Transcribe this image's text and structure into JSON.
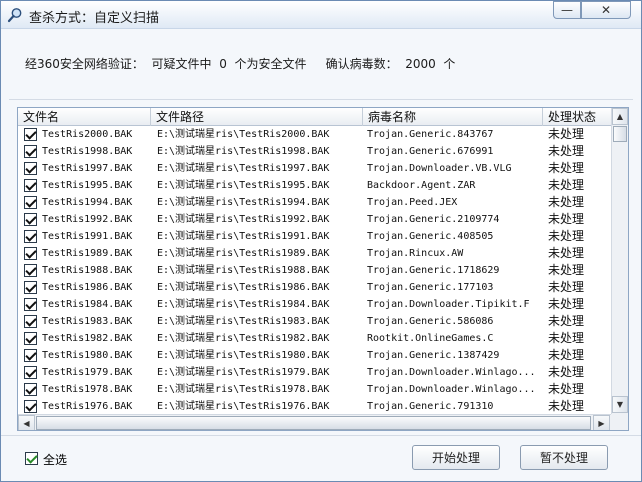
{
  "window": {
    "title": "查杀方式：自定义扫描",
    "min_label": "—",
    "close_label": "✕",
    "title_icon": "magnifier-icon"
  },
  "info": {
    "part1": "经360安全网络验证：",
    "part2": "可疑文件中",
    "safe_count": "0",
    "part3": "个为安全文件",
    "part4": "确认病毒数：",
    "virus_count": "2000",
    "part5": "个"
  },
  "table": {
    "columns": [
      "文件名",
      "文件路径",
      "病毒名称",
      "处理状态"
    ],
    "rows": [
      {
        "file": "TestRis2000.BAK",
        "path": "E:\\测试瑞星ris\\TestRis2000.BAK",
        "virus": "Trojan.Generic.843767",
        "status": "未处理"
      },
      {
        "file": "TestRis1998.BAK",
        "path": "E:\\测试瑞星ris\\TestRis1998.BAK",
        "virus": "Trojan.Generic.676991",
        "status": "未处理"
      },
      {
        "file": "TestRis1997.BAK",
        "path": "E:\\测试瑞星ris\\TestRis1997.BAK",
        "virus": "Trojan.Downloader.VB.VLG",
        "status": "未处理"
      },
      {
        "file": "TestRis1995.BAK",
        "path": "E:\\测试瑞星ris\\TestRis1995.BAK",
        "virus": "Backdoor.Agent.ZAR",
        "status": "未处理"
      },
      {
        "file": "TestRis1994.BAK",
        "path": "E:\\测试瑞星ris\\TestRis1994.BAK",
        "virus": "Trojan.Peed.JEX",
        "status": "未处理"
      },
      {
        "file": "TestRis1992.BAK",
        "path": "E:\\测试瑞星ris\\TestRis1992.BAK",
        "virus": "Trojan.Generic.2109774",
        "status": "未处理"
      },
      {
        "file": "TestRis1991.BAK",
        "path": "E:\\测试瑞星ris\\TestRis1991.BAK",
        "virus": "Trojan.Generic.408505",
        "status": "未处理"
      },
      {
        "file": "TestRis1989.BAK",
        "path": "E:\\测试瑞星ris\\TestRis1989.BAK",
        "virus": "Trojan.Rincux.AW",
        "status": "未处理"
      },
      {
        "file": "TestRis1988.BAK",
        "path": "E:\\测试瑞星ris\\TestRis1988.BAK",
        "virus": "Trojan.Generic.1718629",
        "status": "未处理"
      },
      {
        "file": "TestRis1986.BAK",
        "path": "E:\\测试瑞星ris\\TestRis1986.BAK",
        "virus": "Trojan.Generic.177103",
        "status": "未处理"
      },
      {
        "file": "TestRis1984.BAK",
        "path": "E:\\测试瑞星ris\\TestRis1984.BAK",
        "virus": "Trojan.Downloader.Tipikit.F",
        "status": "未处理"
      },
      {
        "file": "TestRis1983.BAK",
        "path": "E:\\测试瑞星ris\\TestRis1983.BAK",
        "virus": "Trojan.Generic.586086",
        "status": "未处理"
      },
      {
        "file": "TestRis1982.BAK",
        "path": "E:\\测试瑞星ris\\TestRis1982.BAK",
        "virus": "Rootkit.OnlineGames.C",
        "status": "未处理"
      },
      {
        "file": "TestRis1980.BAK",
        "path": "E:\\测试瑞星ris\\TestRis1980.BAK",
        "virus": "Trojan.Generic.1387429",
        "status": "未处理"
      },
      {
        "file": "TestRis1979.BAK",
        "path": "E:\\测试瑞星ris\\TestRis1979.BAK",
        "virus": "Trojan.Downloader.Winlago...",
        "status": "未处理"
      },
      {
        "file": "TestRis1978.BAK",
        "path": "E:\\测试瑞星ris\\TestRis1978.BAK",
        "virus": "Trojan.Downloader.Winlago...",
        "status": "未处理"
      },
      {
        "file": "TestRis1976.BAK",
        "path": "E:\\测试瑞星ris\\TestRis1976.BAK",
        "virus": "Trojan.Generic.791310",
        "status": "未处理"
      }
    ]
  },
  "footer": {
    "select_all_label": "全选",
    "start_button": "开始处理",
    "skip_button": "暂不处理"
  }
}
